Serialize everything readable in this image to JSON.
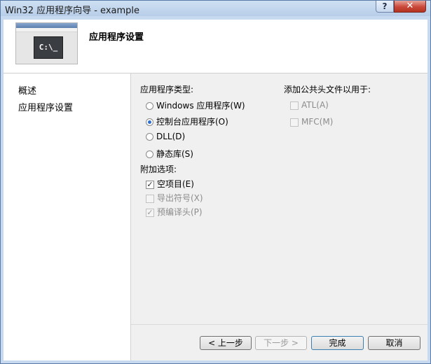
{
  "window": {
    "title": "Win32 应用程序向导 - example",
    "help_label": "?",
    "close_label": "✕"
  },
  "header": {
    "title": "应用程序设置",
    "thumbnail_text": "C:\\_"
  },
  "sidebar": {
    "items": [
      {
        "label": "概述"
      },
      {
        "label": "应用程序设置"
      }
    ]
  },
  "app_type": {
    "label": "应用程序类型:",
    "options": [
      {
        "label": "Windows 应用程序(W)",
        "selected": false
      },
      {
        "label": "控制台应用程序(O)",
        "selected": true
      },
      {
        "label": "DLL(D)",
        "selected": false
      },
      {
        "label": "静态库(S)",
        "selected": false
      }
    ]
  },
  "additional": {
    "label": "附加选项:",
    "options": [
      {
        "label": "空项目(E)",
        "checked": true,
        "enabled": true
      },
      {
        "label": "导出符号(X)",
        "checked": false,
        "enabled": false
      },
      {
        "label": "预编译头(P)",
        "checked": true,
        "enabled": false
      }
    ]
  },
  "headers": {
    "label": "添加公共头文件以用于:",
    "options": [
      {
        "label": "ATL(A)",
        "checked": false,
        "enabled": false
      },
      {
        "label": "MFC(M)",
        "checked": false,
        "enabled": false
      }
    ]
  },
  "buttons": {
    "prev": "< 上一步",
    "next": "下一步 >",
    "finish": "完成",
    "cancel": "取消"
  },
  "colors": {
    "accent": "#2b6fd6",
    "title_bar": "#c7d9ee",
    "close": "#c9483a"
  }
}
